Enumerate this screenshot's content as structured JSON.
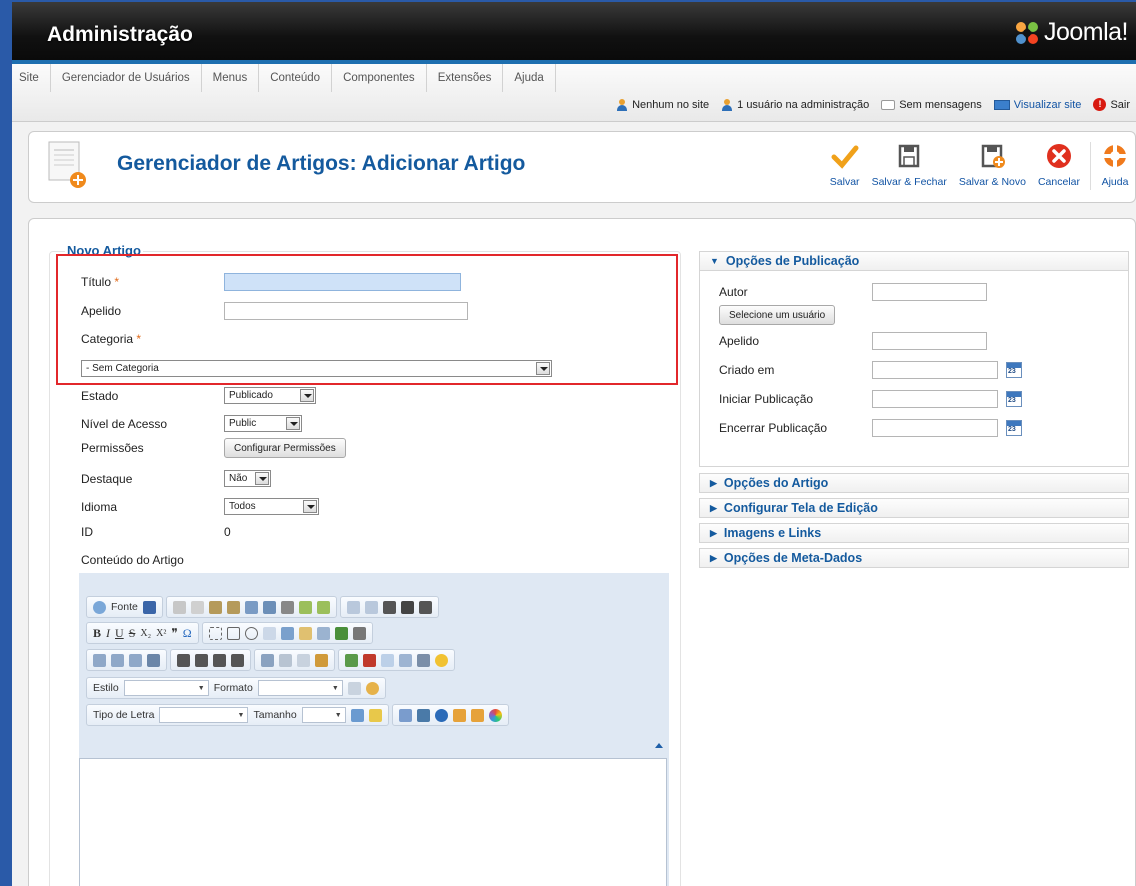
{
  "header": {
    "title": "Administração",
    "brand": "Joomla!"
  },
  "menu": [
    "Site",
    "Gerenciador de Usuários",
    "Menus",
    "Conteúdo",
    "Componentes",
    "Extensões",
    "Ajuda"
  ],
  "status": {
    "site_users": "Nenhum no site",
    "admin_users": "1 usuário na administração",
    "messages": "Sem mensagens",
    "view_site": "Visualizar site",
    "logout": "Sair"
  },
  "toolbar": {
    "page_title": "Gerenciador de Artigos: Adicionar Artigo",
    "save": "Salvar",
    "save_close": "Salvar & Fechar",
    "save_new": "Salvar & Novo",
    "cancel": "Cancelar",
    "help": "Ajuda"
  },
  "form": {
    "legend": "Novo Artigo",
    "title_label": "Título",
    "alias_label": "Apelido",
    "category_label": "Categoria",
    "category_value": "- Sem Categoria",
    "state_label": "Estado",
    "state_value": "Publicado",
    "access_label": "Nível de Acesso",
    "access_value": "Public",
    "permissions_label": "Permissões",
    "permissions_button": "Configurar Permissões",
    "featured_label": "Destaque",
    "featured_value": "Não",
    "language_label": "Idioma",
    "language_value": "Todos",
    "id_label": "ID",
    "id_value": "0",
    "content_label": "Conteúdo do Artigo",
    "required_mark": "*"
  },
  "editor": {
    "source_label": "Fonte",
    "style_label": "Estilo",
    "format_label": "Formato",
    "font_label": "Tipo de Letra",
    "size_label": "Tamanho",
    "bold": "B",
    "italic": "I",
    "underline": "U",
    "strike": "S",
    "subscript": "X₂",
    "superscript": "X²",
    "quote": "❞",
    "omega": "Ω"
  },
  "publishing": {
    "header": "Opções de Publicação",
    "author_label": "Autor",
    "select_user_button": "Selecione um usuário",
    "alias_label": "Apelido",
    "created_label": "Criado em",
    "publish_up_label": "Iniciar Publicação",
    "publish_down_label": "Encerrar Publicação",
    "cal_day": "23"
  },
  "panes": [
    "Opções do Artigo",
    "Configurar Tela de Edição",
    "Imagens e Links",
    "Opções de Meta-Dados"
  ],
  "colors": {
    "accent": "#145a9e",
    "highlight": "#e2272b",
    "link": "#1254a4"
  }
}
